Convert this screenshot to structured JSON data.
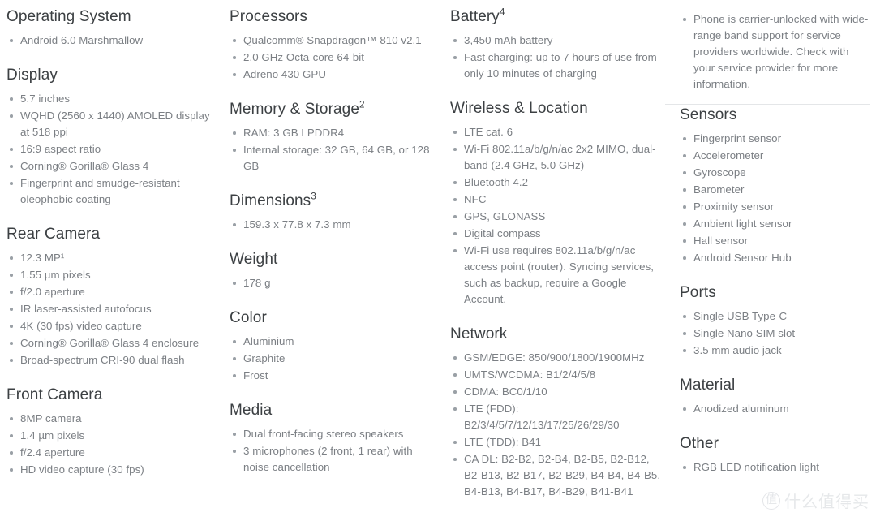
{
  "page": {
    "background_color": "#ffffff",
    "heading_color": "#3c4043",
    "body_color": "#7b7f84",
    "bullet_color": "#9aa0a6"
  },
  "columns": [
    {
      "id": "column-1",
      "sections": [
        {
          "id": "operating-system",
          "title": "Operating System",
          "superscript": "",
          "items": [
            "Android 6.0 Marshmallow"
          ]
        },
        {
          "id": "display",
          "title": "Display",
          "superscript": "",
          "items": [
            "5.7 inches",
            "WQHD (2560 x 1440) AMOLED display at 518 ppi",
            "16:9 aspect ratio",
            "Corning® Gorilla® Glass 4",
            "Fingerprint and smudge-resistant oleophobic coating"
          ]
        },
        {
          "id": "rear-camera",
          "title": "Rear Camera",
          "superscript": "",
          "items": [
            "12.3 MP¹",
            "1.55 µm pixels",
            "f/2.0 aperture",
            "IR laser-assisted autofocus",
            "4K (30 fps) video capture",
            "Corning® Gorilla® Glass 4 enclosure",
            "Broad-spectrum CRI-90 dual flash"
          ]
        },
        {
          "id": "front-camera",
          "title": "Front Camera",
          "superscript": "",
          "items": [
            "8MP camera",
            "1.4 µm pixels",
            "f/2.4 aperture",
            "HD video capture (30 fps)"
          ]
        }
      ]
    },
    {
      "id": "column-2",
      "sections": [
        {
          "id": "processors",
          "title": "Processors",
          "superscript": "",
          "items": [
            "Qualcomm® Snapdragon™ 810 v2.1",
            "2.0 GHz Octa-core 64-bit",
            "Adreno 430 GPU"
          ]
        },
        {
          "id": "memory-storage",
          "title": "Memory & Storage",
          "superscript": "2",
          "items": [
            "RAM: 3 GB LPDDR4",
            "Internal storage: 32 GB, 64 GB, or 128 GB"
          ]
        },
        {
          "id": "dimensions",
          "title": "Dimensions",
          "superscript": "3",
          "items": [
            "159.3 x 77.8 x 7.3 mm"
          ]
        },
        {
          "id": "weight",
          "title": "Weight",
          "superscript": "",
          "items": [
            "178 g"
          ]
        },
        {
          "id": "color",
          "title": "Color",
          "superscript": "",
          "items": [
            "Aluminium",
            "Graphite",
            "Frost"
          ]
        },
        {
          "id": "media",
          "title": "Media",
          "superscript": "",
          "items": [
            "Dual front-facing stereo speakers",
            "3 microphones (2 front, 1 rear) with noise cancellation"
          ]
        }
      ]
    },
    {
      "id": "column-3",
      "sections": [
        {
          "id": "battery",
          "title": "Battery",
          "superscript": "4",
          "items": [
            "3,450 mAh battery",
            "Fast charging: up to 7 hours of use from only 10 minutes of charging"
          ]
        },
        {
          "id": "wireless-location",
          "title": "Wireless & Location",
          "superscript": "",
          "items": [
            "LTE cat. 6",
            "Wi-Fi 802.11a/b/g/n/ac 2x2 MIMO, dual-band (2.4 GHz, 5.0 GHz)",
            "Bluetooth 4.2",
            "NFC",
            "GPS, GLONASS",
            "Digital compass",
            "Wi-Fi use requires 802.11a/b/g/n/ac access point (router). Syncing services, such as backup, require a Google Account."
          ]
        },
        {
          "id": "network",
          "title": "Network",
          "superscript": "",
          "items": [
            "GSM/EDGE: 850/900/1800/1900MHz",
            "UMTS/WCDMA: B1/2/4/5/8",
            "CDMA: BC0/1/10",
            "LTE (FDD): B2/3/4/5/7/12/13/17/25/26/29/30",
            "LTE (TDD): B41",
            "CA DL: B2-B2, B2-B4, B2-B5, B2-B12, B2-B13, B2-B17, B2-B29, B4-B4, B4-B5, B4-B13, B4-B17, B4-B29, B41-B41"
          ]
        }
      ]
    },
    {
      "id": "column-4",
      "lead_items": [
        "Phone is carrier-unlocked with wide-range band support for service providers worldwide. Check with your service provider for more information."
      ],
      "has_divider": true,
      "sections": [
        {
          "id": "sensors",
          "title": "Sensors",
          "superscript": "",
          "items": [
            "Fingerprint sensor",
            "Accelerometer",
            "Gyroscope",
            "Barometer",
            "Proximity sensor",
            "Ambient light sensor",
            "Hall sensor",
            "Android Sensor Hub"
          ]
        },
        {
          "id": "ports",
          "title": "Ports",
          "superscript": "",
          "items": [
            "Single USB Type-C",
            "Single Nano SIM slot",
            "3.5 mm audio jack"
          ]
        },
        {
          "id": "material",
          "title": "Material",
          "superscript": "",
          "items": [
            "Anodized aluminum"
          ]
        },
        {
          "id": "other",
          "title": "Other",
          "superscript": "",
          "items": [
            "RGB LED notification light"
          ]
        }
      ]
    }
  ],
  "watermark": {
    "badge": "值",
    "text": "什么值得买"
  }
}
